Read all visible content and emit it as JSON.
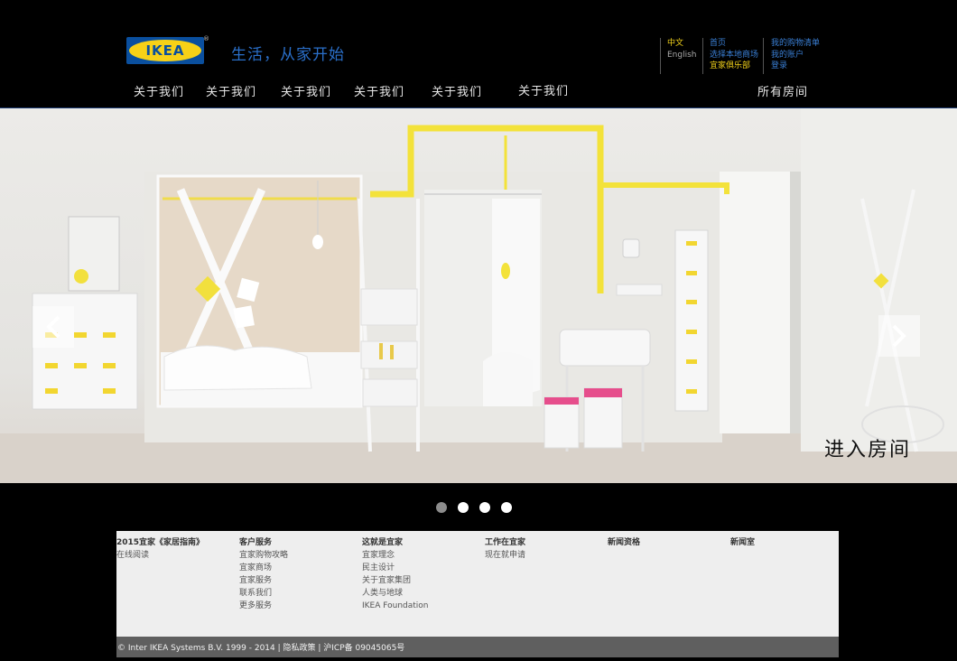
{
  "header": {
    "logo_text": "IKEA",
    "logo_mark": "®",
    "tagline": "生活，从家开始",
    "language": {
      "current": "中文",
      "alternate": "English"
    },
    "links_primary": [
      "首页",
      "选择本地商场",
      "宜家俱乐部"
    ],
    "links_account": [
      "我的购物清单",
      "我的账户",
      "登录"
    ]
  },
  "nav": {
    "items": [
      "关于我们",
      "关于我们",
      "关于我们",
      "关于我们",
      "关于我们",
      "关于我们"
    ],
    "all_rooms": "所有房间"
  },
  "hero": {
    "cta": "进入房间",
    "prev_icon": "chevron-left-icon",
    "next_icon": "chevron-right-icon",
    "slides_count": 4,
    "active_slide": 1
  },
  "footer": {
    "columns": [
      {
        "title": "2015宜家《家居指南》",
        "links": [
          "在线阅读"
        ]
      },
      {
        "title": "客户服务",
        "links": [
          "宜家购物攻略",
          "宜家商场",
          "宜家服务",
          "联系我们",
          "更多服务"
        ]
      },
      {
        "title": "这就是宜家",
        "links": [
          "宜家理念",
          "民主设计",
          "关于宜家集团",
          "人类与地球",
          "IKEA Foundation"
        ]
      },
      {
        "title": "工作在宜家",
        "links": [
          "现在就申请"
        ]
      },
      {
        "title": "新闻资格",
        "links": []
      },
      {
        "title": "新闻室",
        "links": []
      }
    ],
    "copyright": "© Inter IKEA Systems B.V. 1999 - 2014 | 隐私政策 | 沪ICP备 09045065号"
  },
  "colors": {
    "brand_blue": "#0a4f9e",
    "brand_yellow": "#f7d117",
    "link_blue": "#3a7fd5",
    "accent_yellow": "#f2d21a",
    "page_bg": "#000000"
  }
}
